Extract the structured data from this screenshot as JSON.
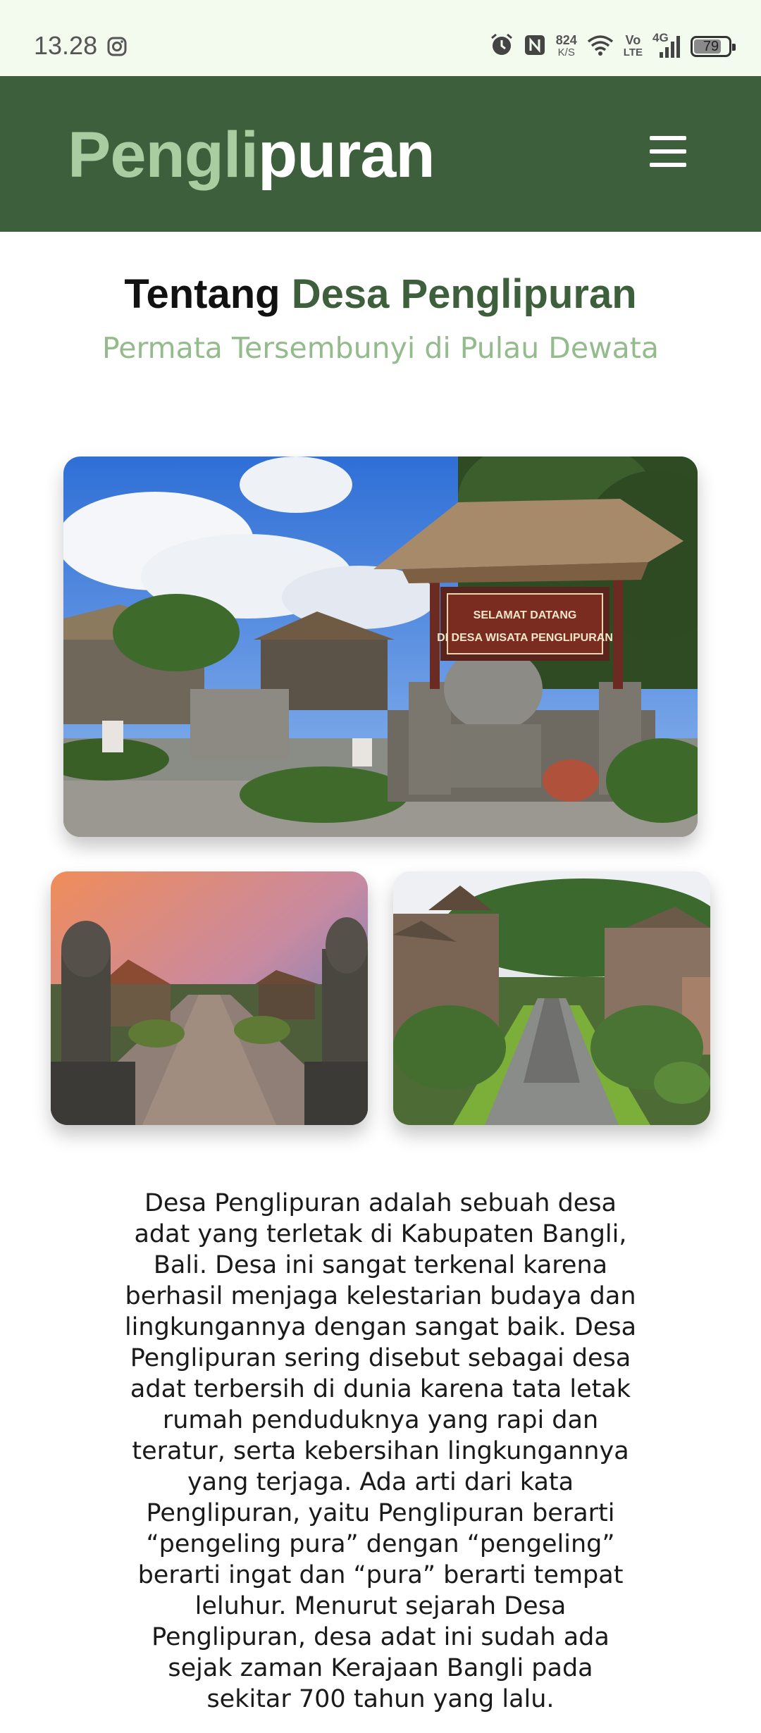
{
  "status_bar": {
    "time": "13.28",
    "net_speed_value": "824",
    "net_speed_unit": "K/S",
    "volte_top": "Vo",
    "volte_bottom": "LTE",
    "network": "4G",
    "battery": "79",
    "battery_level": 0.79,
    "icons": [
      "instagram-icon",
      "alarm-icon",
      "nfc-icon",
      "wifi-icon",
      "signal-icon",
      "battery-icon"
    ]
  },
  "header": {
    "logo_part1": "Pengli",
    "logo_part2": "puran",
    "menu_icon": "hamburger-menu-icon",
    "colors": {
      "background": "#3e5f3b",
      "logo_accent": "#a9cda0"
    }
  },
  "section": {
    "title_part1": "Tentang",
    "title_part2": "Desa Penglipuran",
    "subtitle": "Permata Tersembunyi di Pulau Dewata"
  },
  "images": {
    "main_sign_line1": "SELAMAT DATANG",
    "main_sign_line2": "DI DESA WISATA PENGLIPURAN"
  },
  "description": "Desa Penglipuran adalah sebuah desa adat yang terletak di Kabupaten Bangli, Bali. Desa ini sangat terkenal karena berhasil menjaga kelestarian budaya dan lingkungannya dengan sangat baik. Desa Penglipuran sering disebut sebagai desa adat terbersih di dunia karena tata letak rumah penduduknya yang rapi dan teratur, serta kebersihan lingkungannya yang terjaga. Ada arti dari kata Penglipuran, yaitu Penglipuran berarti “pengeling pura” dengan “pengeling” berarti ingat dan “pura” berarti tempat leluhur. Menurut sejarah Desa Penglipuran, desa adat ini sudah ada sejak zaman Kerajaan Bangli pada sekitar 700 tahun yang lalu."
}
